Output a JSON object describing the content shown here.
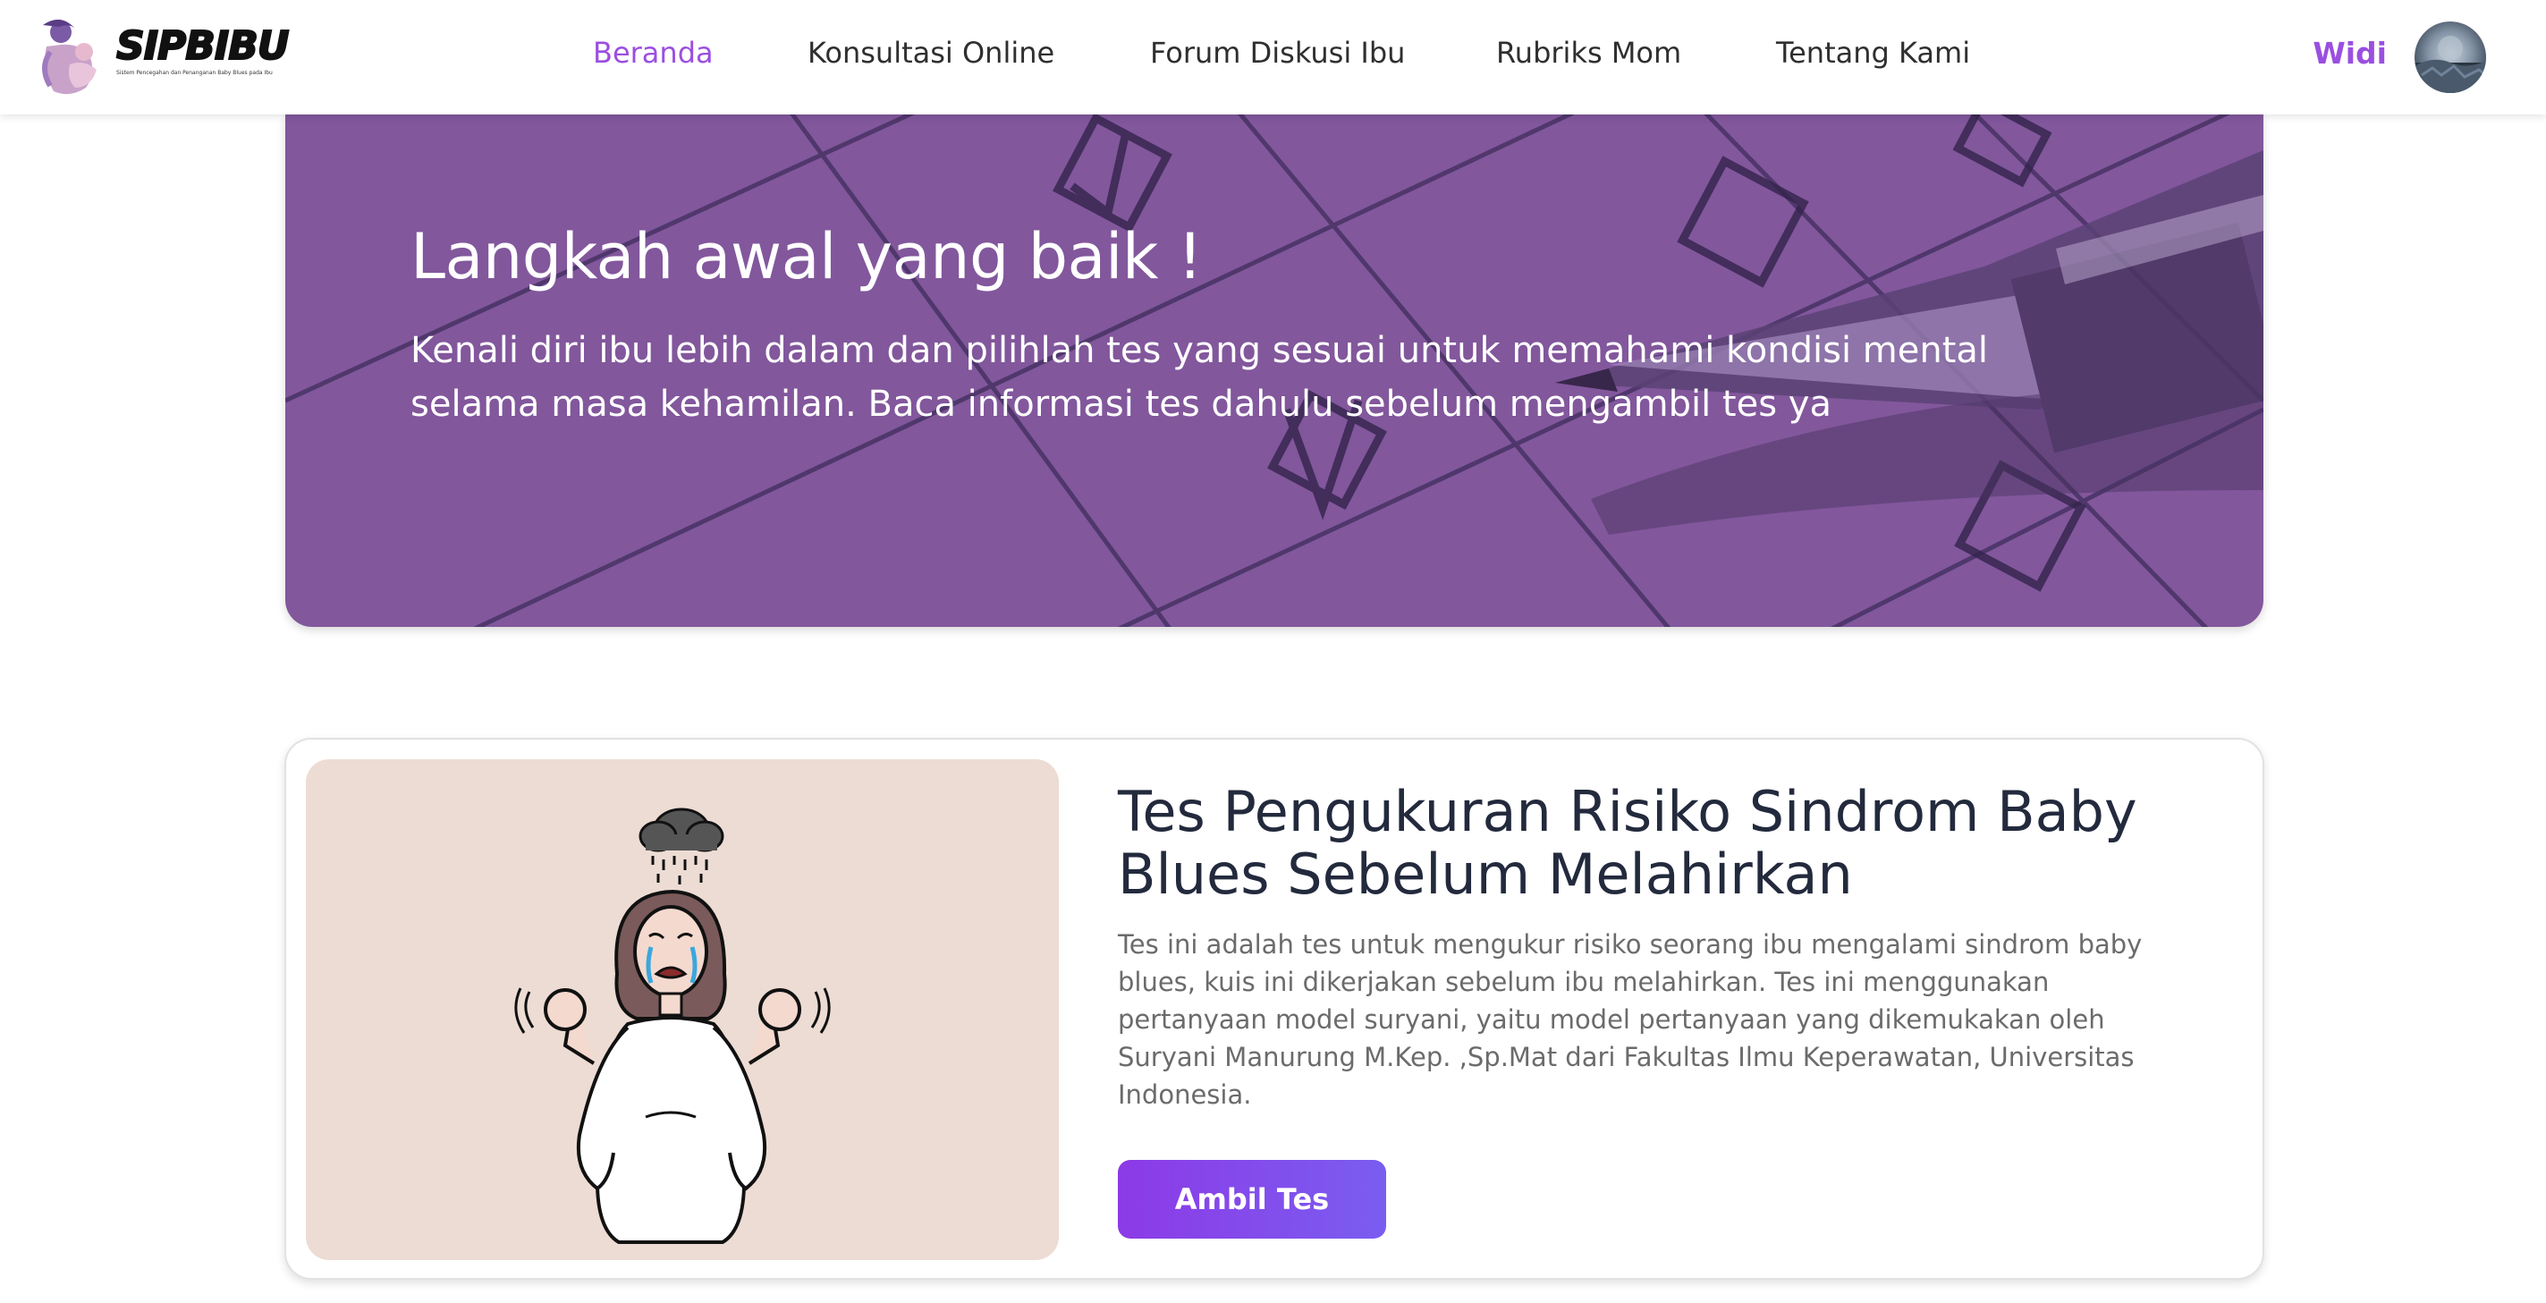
{
  "nav": {
    "logo_text": "SIPBIBU",
    "logo_tagline": "Sistem Pencegahan dan Penanganan Baby Blues pada Ibu",
    "links": [
      {
        "label": "Beranda",
        "active": true
      },
      {
        "label": "Konsultasi Online",
        "active": false
      },
      {
        "label": "Forum Diskusi Ibu",
        "active": false
      },
      {
        "label": "Rubriks Mom",
        "active": false
      },
      {
        "label": "Tentang Kami",
        "active": false
      }
    ],
    "user_name": "Widi",
    "active_color": "#9b4fe0"
  },
  "hero": {
    "title": "Langkah awal yang baik !",
    "text": "Kenali diri ibu lebih dalam dan pilihlah tes yang sesuai untuk memahami kondisi mental selama masa kehamilan. Baca informasi tes dahulu sebelum mengambil tes ya",
    "background_color": "#82579c"
  },
  "test_card": {
    "image_icon": "crying-pregnant-woman-illustration",
    "title": "Tes Pengukuran Risiko Sindrom Baby Blues Sebelum Melahirkan",
    "description": "Tes ini adalah tes untuk mengukur risiko seorang ibu mengalami sindrom baby blues, kuis ini dikerjakan sebelum ibu melahirkan. Tes ini menggunakan pertanyaan model suryani, yaitu model pertanyaan yang dikemukakan oleh Suryani Manurung M.Kep. ,Sp.Mat dari Fakultas Ilmu Keperawatan, Universitas Indonesia.",
    "button_label": "Ambil Tes",
    "button_color": "#8c3ae6"
  }
}
